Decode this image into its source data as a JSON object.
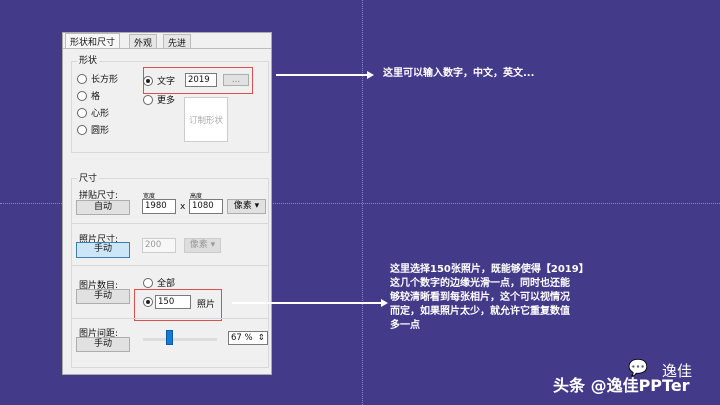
{
  "tabs": [
    "形状和尺寸",
    "外观",
    "先进"
  ],
  "shape": {
    "title": "形状",
    "options": [
      "长方形",
      "格",
      "心形",
      "圆形"
    ],
    "text_label": "文字",
    "text_value": "2019",
    "browse": "...",
    "more": "更多",
    "custom": "订制形状"
  },
  "size": {
    "title": "尺寸",
    "mosaic_label": "拼贴尺寸:",
    "mosaic_btn": "自动",
    "width_label": "宽度",
    "height_label": "高度",
    "width": "1980",
    "x": "x",
    "height": "1080",
    "unit": "像素 ▾",
    "photo_label": "照片尺寸:",
    "photo_btn": "手动",
    "photo_value": "200",
    "photo_unit": "像素 ▾",
    "count_label": "图片数目:",
    "count_btn": "手动",
    "all": "全部",
    "count_value": "150",
    "count_unit": "照片",
    "spacing_label": "图片间距:",
    "spacing_btn": "手动",
    "spacing_value": "67 %"
  },
  "spacing_fraction": 0.35,
  "notes": {
    "top": "这里可以输入数字，中文，英文...",
    "bottom": [
      "这里选择150张照片，既能够使得【2019】",
      "这几个数字的边缘光滑一点，同时也还能",
      "够较清晰看到每张相片，这个可以视情况",
      "而定，如果照片太少，就允许它重复数值",
      "多一点"
    ]
  },
  "watermark": {
    "brand": "逸佳",
    "credit": "头条 @逸佳PPTer"
  }
}
